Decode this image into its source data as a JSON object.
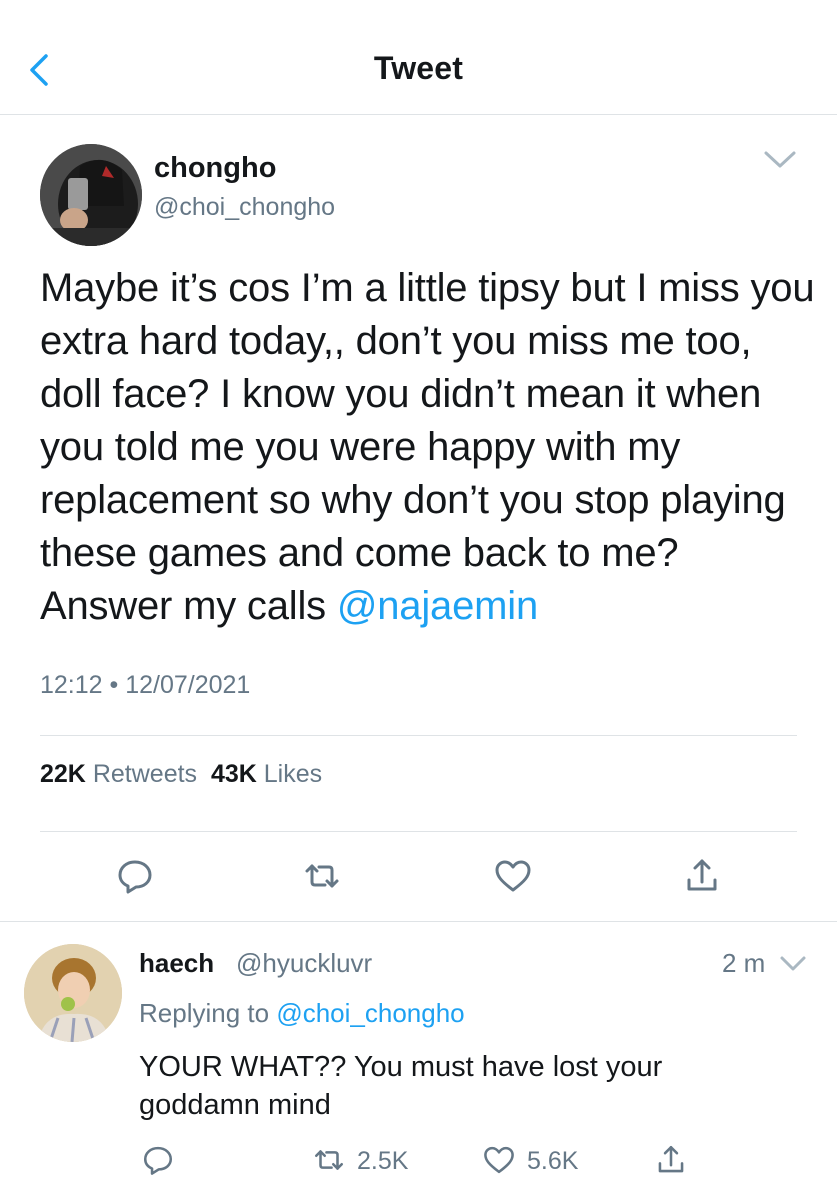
{
  "header": {
    "title": "Tweet",
    "back_icon": "chevron-left-icon"
  },
  "tweet": {
    "author_name": "chongho",
    "author_handle": "@choi_chongho",
    "text_before": "Maybe it’s cos I’m a little tipsy but I miss you extra hard today,, don’t you miss me too, doll face? I know you didn’t mean it when you told me you were happy with my replacement so why don’t you stop playing these games and come back to me? Answer my calls ",
    "mention": "@najaemin",
    "time": "12:12 • 12/07/2021",
    "retweets_count": "22K",
    "retweets_label": "Retweets",
    "likes_count": "43K",
    "likes_label": "Likes"
  },
  "reply": {
    "name": "haech",
    "handle": "@hyuckluvr",
    "time": "2 m",
    "replying_prefix": "Replying to ",
    "replying_handle": "@choi_chongho",
    "text": "YOUR WHAT?? You must have lost your goddamn mind",
    "retweets": "2.5K",
    "likes": "5.6K"
  },
  "colors": {
    "accent": "#1da1f2",
    "muted": "#657786",
    "text": "#14171a",
    "divider": "#dfe3e6"
  }
}
